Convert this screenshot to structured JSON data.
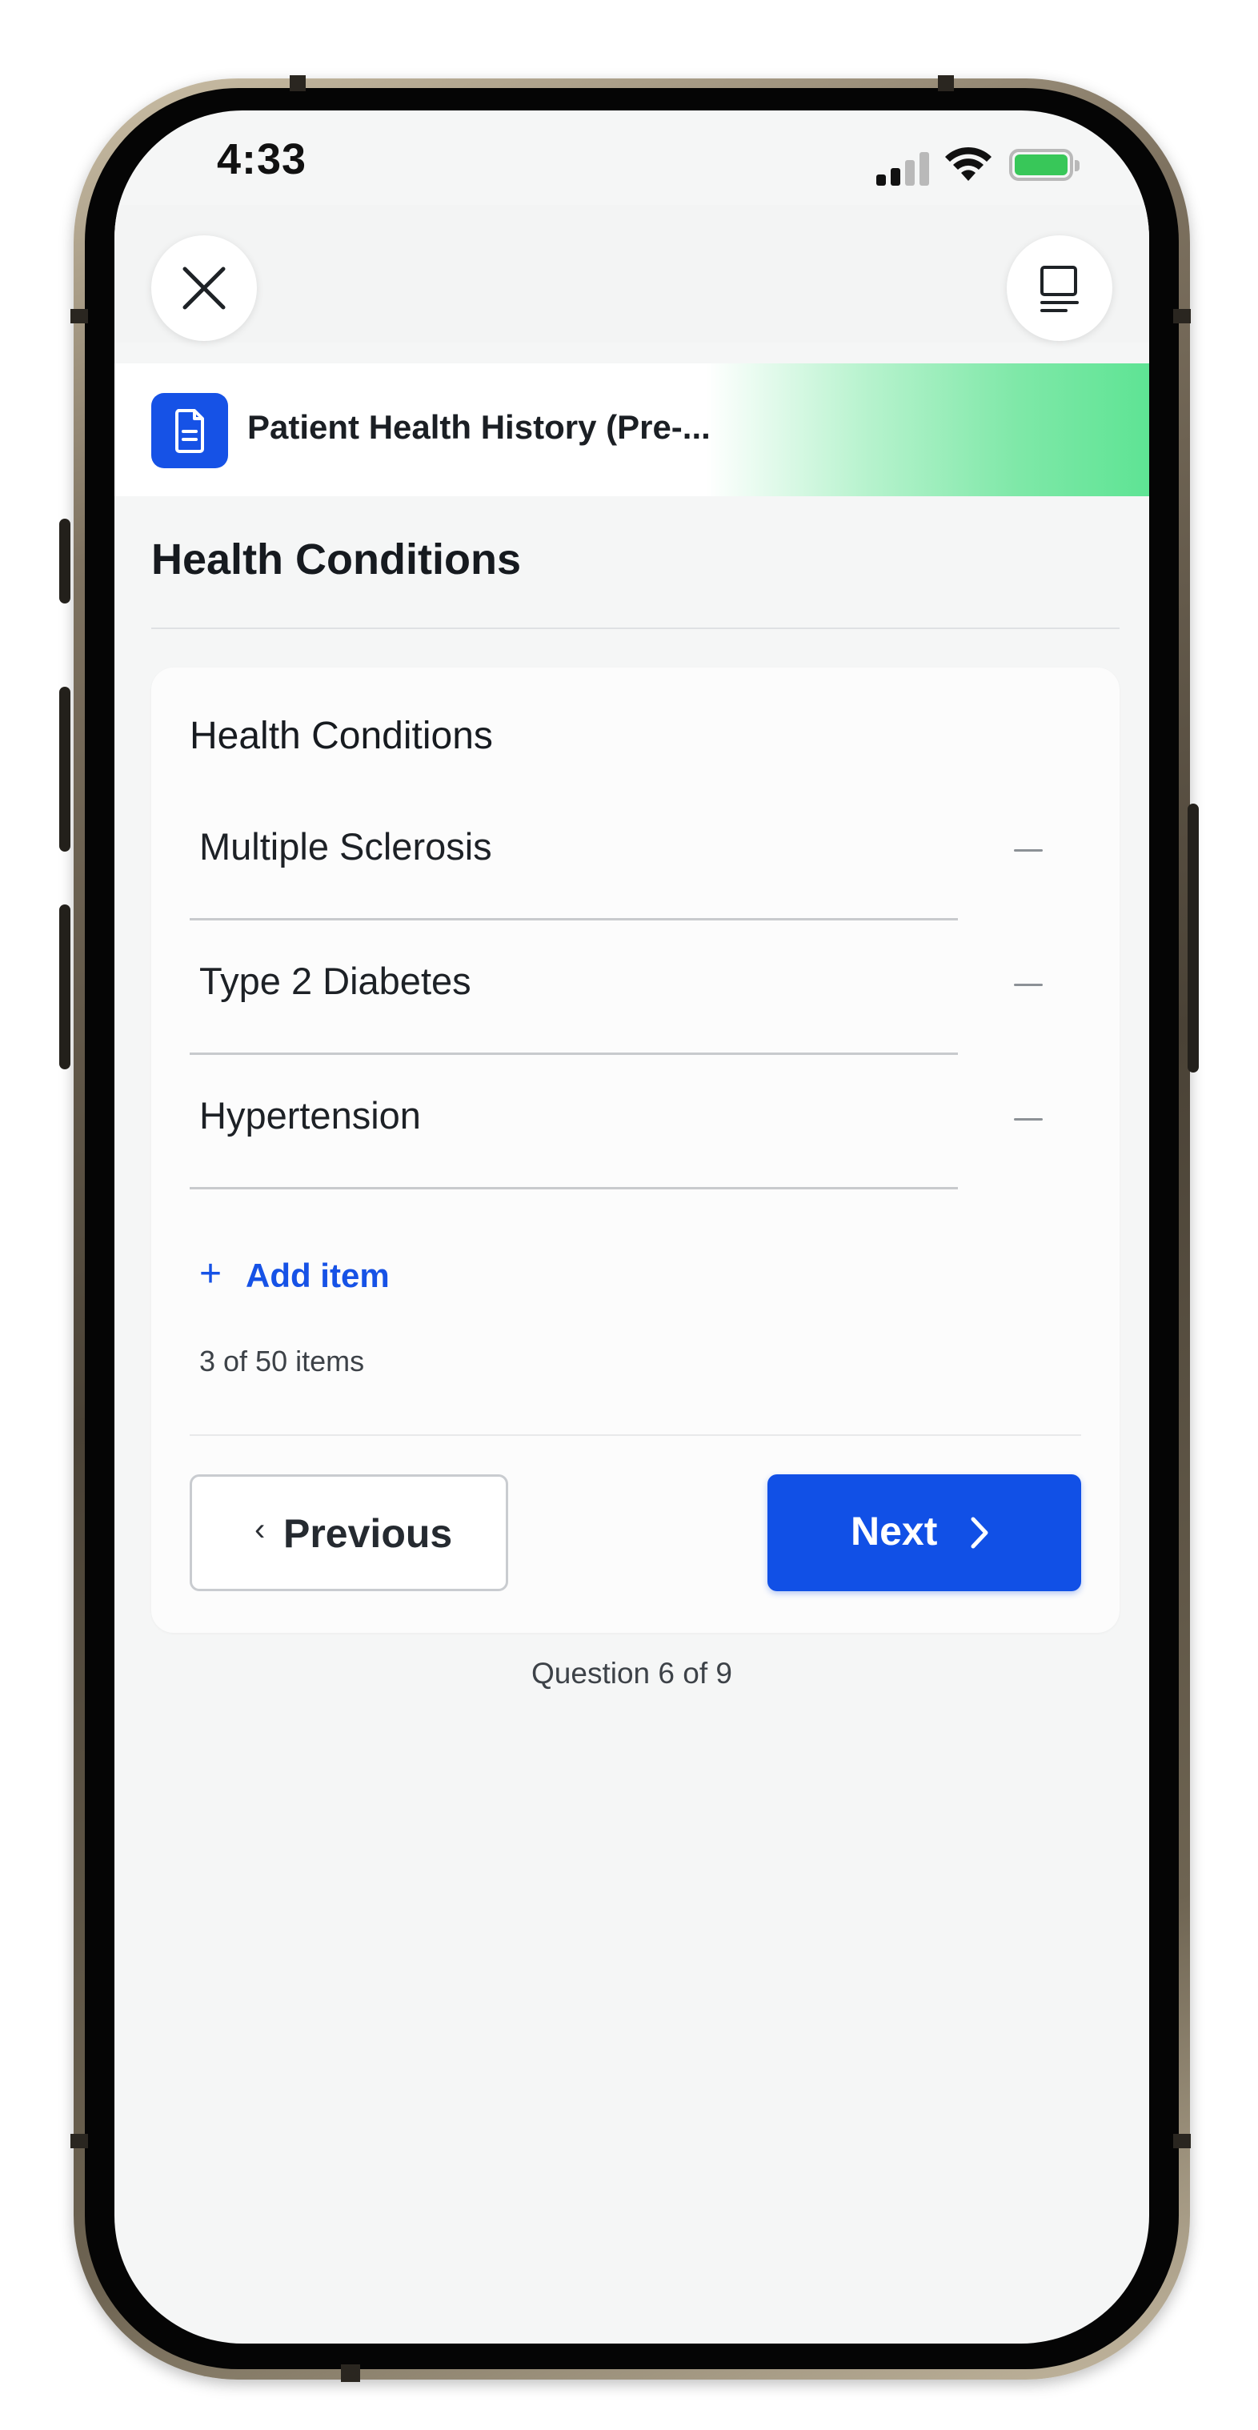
{
  "status_bar": {
    "time": "4:33"
  },
  "header": {
    "close_icon": "close-icon",
    "menu_icon": "list-icon"
  },
  "form": {
    "title": "Patient Health History (Pre-...",
    "icon": "document-icon",
    "accent_color": "#1652e6"
  },
  "section": {
    "title": "Health Conditions"
  },
  "question": {
    "label": "Health Conditions",
    "items": [
      {
        "text": "Multiple Sclerosis"
      },
      {
        "text": "Type 2 Diabetes"
      },
      {
        "text": "Hypertension"
      }
    ],
    "add_label": "Add item",
    "count_text": "3 of 50 items"
  },
  "nav": {
    "previous_label": "Previous",
    "next_label": "Next",
    "next_color": "#1150e6"
  },
  "progress": {
    "text": "Question 6 of 9"
  }
}
